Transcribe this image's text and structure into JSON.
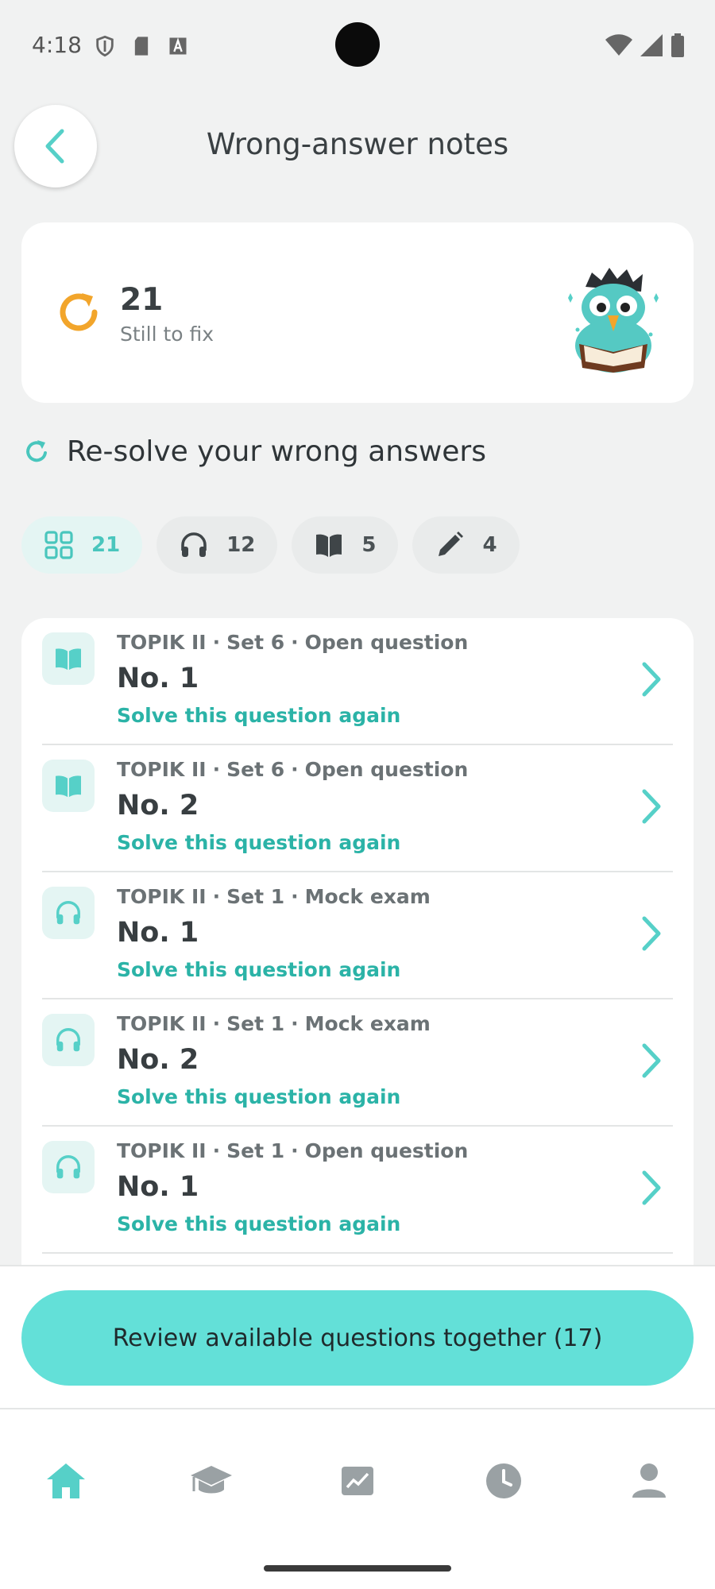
{
  "status_bar": {
    "time": "4:18"
  },
  "header": {
    "title": "Wrong-answer notes"
  },
  "summary": {
    "count": "21",
    "label": "Still to fix"
  },
  "section": {
    "title": "Re-solve your wrong answers"
  },
  "filters": [
    {
      "icon": "grid-icon",
      "count": "21",
      "active": true
    },
    {
      "icon": "headphones-icon",
      "count": "12",
      "active": false
    },
    {
      "icon": "book-icon",
      "count": "5",
      "active": false
    },
    {
      "icon": "pencil-icon",
      "count": "4",
      "active": false
    }
  ],
  "questions": [
    {
      "icon": "book-icon",
      "exam": "TOPIK II",
      "set": "Set 6",
      "type": "Open question",
      "number": "No. 1",
      "action": "Solve this question again"
    },
    {
      "icon": "book-icon",
      "exam": "TOPIK II",
      "set": "Set 6",
      "type": "Open question",
      "number": "No. 2",
      "action": "Solve this question again"
    },
    {
      "icon": "headphones-icon",
      "exam": "TOPIK II",
      "set": "Set 1",
      "type": "Mock exam",
      "number": "No. 1",
      "action": "Solve this question again"
    },
    {
      "icon": "headphones-icon",
      "exam": "TOPIK II",
      "set": "Set 1",
      "type": "Mock exam",
      "number": "No. 2",
      "action": "Solve this question again"
    },
    {
      "icon": "headphones-icon",
      "exam": "TOPIK II",
      "set": "Set 1",
      "type": "Open question",
      "number": "No. 1",
      "action": "Solve this question again"
    }
  ],
  "bottom": {
    "review_label": "Review available questions together (17)"
  },
  "tabbar": {
    "items": [
      "home-icon",
      "graduation-cap-icon",
      "chart-icon",
      "clock-icon",
      "profile-icon"
    ],
    "active": "home-icon"
  },
  "colors": {
    "accent": "#49c6bd",
    "accent_text": "#2bb3a7",
    "button": "#63e0d8",
    "refresh_orange": "#f2a52b"
  },
  "meta_separator": "·"
}
